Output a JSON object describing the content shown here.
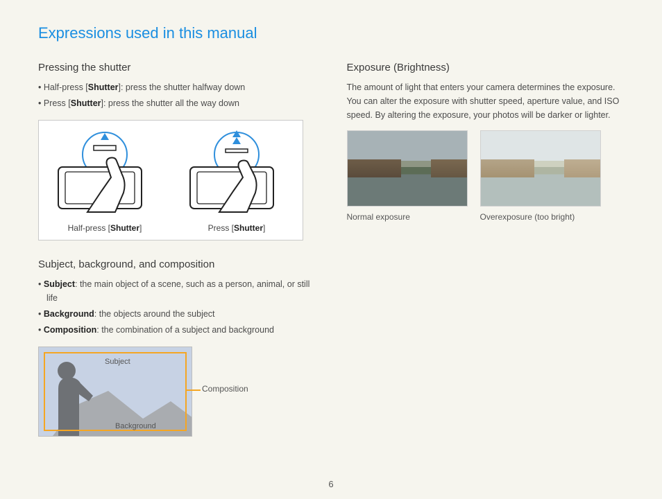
{
  "title": "Expressions used in this manual",
  "left": {
    "sec1": {
      "heading": "Pressing the shutter",
      "items": [
        {
          "pre": "Half-press [",
          "bold": "Shutter",
          "post": "]: press the shutter halfway down"
        },
        {
          "pre": "Press [",
          "bold": "Shutter",
          "post": "]: press the shutter all the way down"
        }
      ],
      "figs": [
        {
          "cap_pre": "Half-press [",
          "cap_bold": "Shutter",
          "cap_post": "]",
          "arrows": 1
        },
        {
          "cap_pre": "Press [",
          "cap_bold": "Shutter",
          "cap_post": "]",
          "arrows": 2
        }
      ]
    },
    "sec2": {
      "heading": "Subject, background, and composition",
      "items": [
        {
          "bold": "Subject",
          "post": ": the main object of a scene, such as a person, animal, or still life"
        },
        {
          "bold": "Background",
          "post": ": the objects around the subject"
        },
        {
          "bold": "Composition",
          "post": ": the combination of a subject and background"
        }
      ],
      "fig": {
        "subject": "Subject",
        "background": "Background",
        "composition": "Composition"
      }
    }
  },
  "right": {
    "heading": "Exposure (Brightness)",
    "para": "The amount of light that enters your camera determines the exposure. You can alter the exposure with shutter speed, aperture value, and ISO speed. By altering the exposure, your photos will be darker or lighter.",
    "figs": [
      {
        "cap": "Normal exposure",
        "cls": "normal"
      },
      {
        "cap": "Overexposure (too bright)",
        "cls": "over"
      }
    ]
  },
  "pageNumber": "6"
}
